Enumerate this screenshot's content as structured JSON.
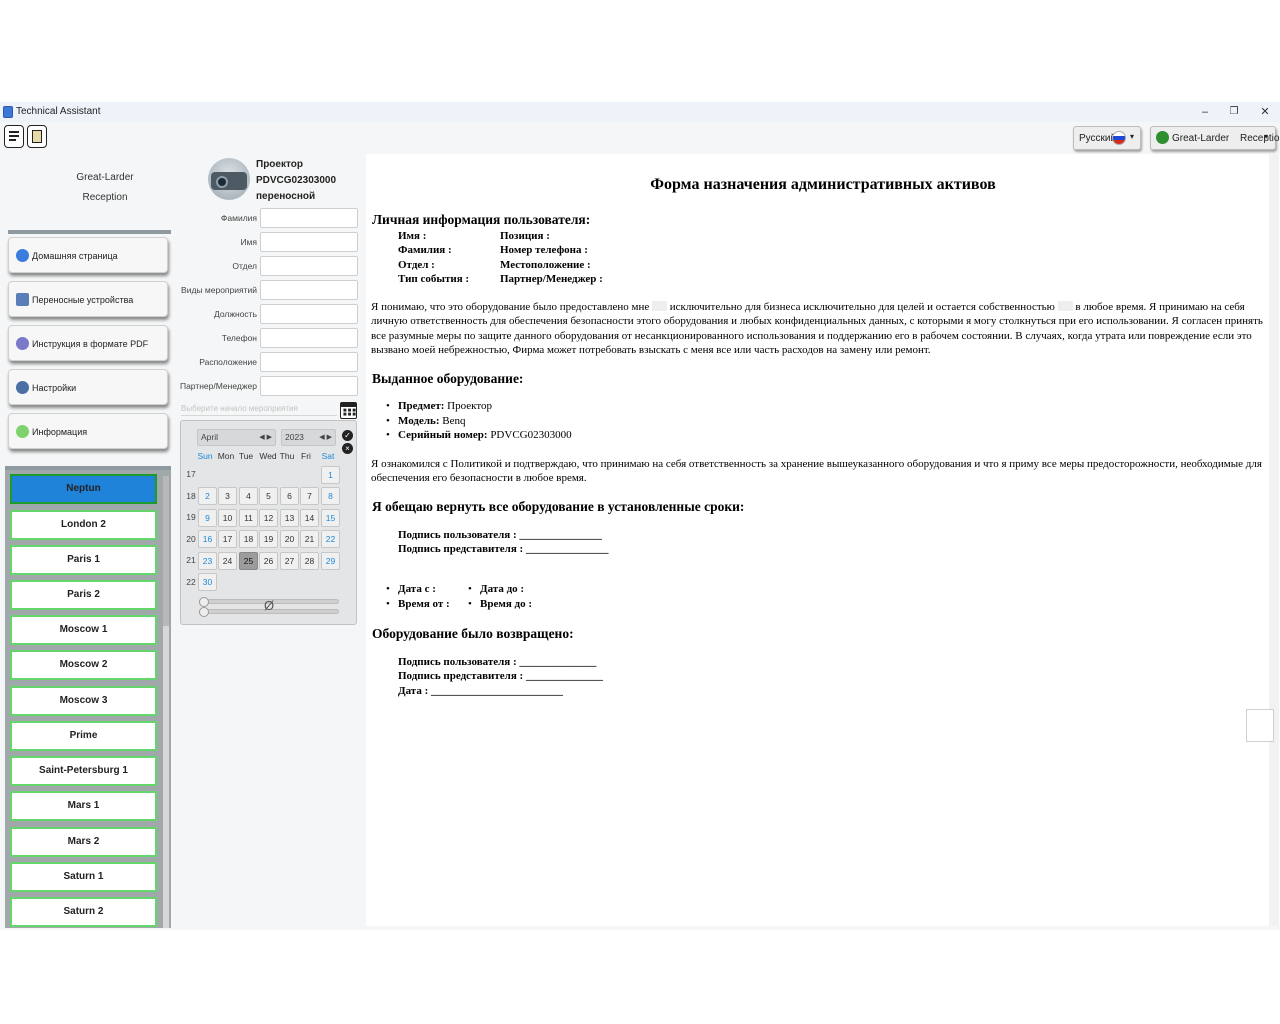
{
  "window": {
    "title": "Technical Assistant",
    "minimize": "–",
    "maximize": "❐",
    "close": "✕"
  },
  "toolbar": {
    "language": "Русский",
    "user_org": "Great-Larder",
    "user_dept": "Reception"
  },
  "sidebar": {
    "org": "Great-Larder",
    "dept": "Reception",
    "nav": [
      {
        "label": "Домашняя страница",
        "icon": "home-icon"
      },
      {
        "label": "Переносные устройства",
        "icon": "devices-icon"
      },
      {
        "label": "Инструкция в формате PDF",
        "icon": "pdf-icon"
      },
      {
        "label": "Настройки",
        "icon": "gear-icon"
      },
      {
        "label": "Информация",
        "icon": "info-icon"
      }
    ],
    "rooms": [
      "Neptun",
      "London 2",
      "Paris 1",
      "Paris 2",
      "Moscow 1",
      "Moscow 2",
      "Moscow 3",
      "Prime",
      "Saint-Petersburg 1",
      "Mars 1",
      "Mars 2",
      "Saturn 1",
      "Saturn 2"
    ]
  },
  "device": {
    "type": "Проектор",
    "serial": "PDVCG02303000",
    "kind": "переносной"
  },
  "form": {
    "fields": [
      "Фамилия",
      "Имя",
      "Отдел",
      "Виды мероприятий",
      "Должность",
      "Телефон",
      "Расположение",
      "Партнер/Менеджер"
    ],
    "date_placeholder": "Выберите начало мероприятия"
  },
  "calendar": {
    "month": "April",
    "year": "2023",
    "dow": [
      "Sun",
      "Mon",
      "Tue",
      "Wed",
      "Thu",
      "Fri",
      "Sat"
    ],
    "weeks": [
      17,
      18,
      19,
      20,
      21,
      22
    ],
    "null_symbol": "Ø",
    "today": 25
  },
  "doc": {
    "title": "Форма назначения административных активов",
    "personal_heading": "Личная информация пользователя:",
    "personal_left": [
      "Имя :",
      "Фамилия :",
      "Отдел :",
      "Тип события :"
    ],
    "personal_right": [
      "Позиция :",
      "Номер телефона :",
      "Местоположение :",
      "Партнер/Менеджер :"
    ],
    "para1_a": "Я понимаю, что это оборудование было предоставлено мне",
    "para1_b": "исключительно для бизнеса исключительно для целей и остается собственностью",
    "para1_c": "в любое время. Я принимаю на себя личную ответственность для обеспечения безопасности этого оборудования и любых конфиденциальных данных, с которыми я могу столкнуться при его использовании. Я согласен принять все разумные меры по защите данного оборудования от несанкционированного использования и поддержанию его в рабочем состоянии. В случаях, когда утрата или повреждение если это вызвано моей небрежностью, Фирма может потребовать взыскать с меня все или часть расходов на замену или ремонт.",
    "issued_heading": "Выданное оборудование:",
    "issued": [
      {
        "label": "Предмет:",
        "value": "Проектор"
      },
      {
        "label": "Модель:",
        "value": "Benq"
      },
      {
        "label": "Серийный номер:",
        "value": "PDVCG02303000"
      }
    ],
    "para2": "Я ознакомился с Политикой и подтверждаю, что принимаю на себя ответственность за хранение вышеуказанного оборудования и что я приму все меры предосторожности, необходимые для обеспечения его безопасности в любое время.",
    "return_heading": "Я обещаю вернуть все оборудование в установленные сроки:",
    "sign_user": "Подпись пользователя : _______________",
    "sign_rep": "Подпись представителя : _______________",
    "date_from": "Дата с :",
    "date_to": "Дата до :",
    "time_from": "Время от :",
    "time_to": "Время до :",
    "returned_heading": "Оборудование было возвращено:",
    "ret_sign_user": "Подпись пользователя : ______________",
    "ret_sign_rep": "Подпись представителя : ______________",
    "ret_date": "Дата : ________________________"
  }
}
